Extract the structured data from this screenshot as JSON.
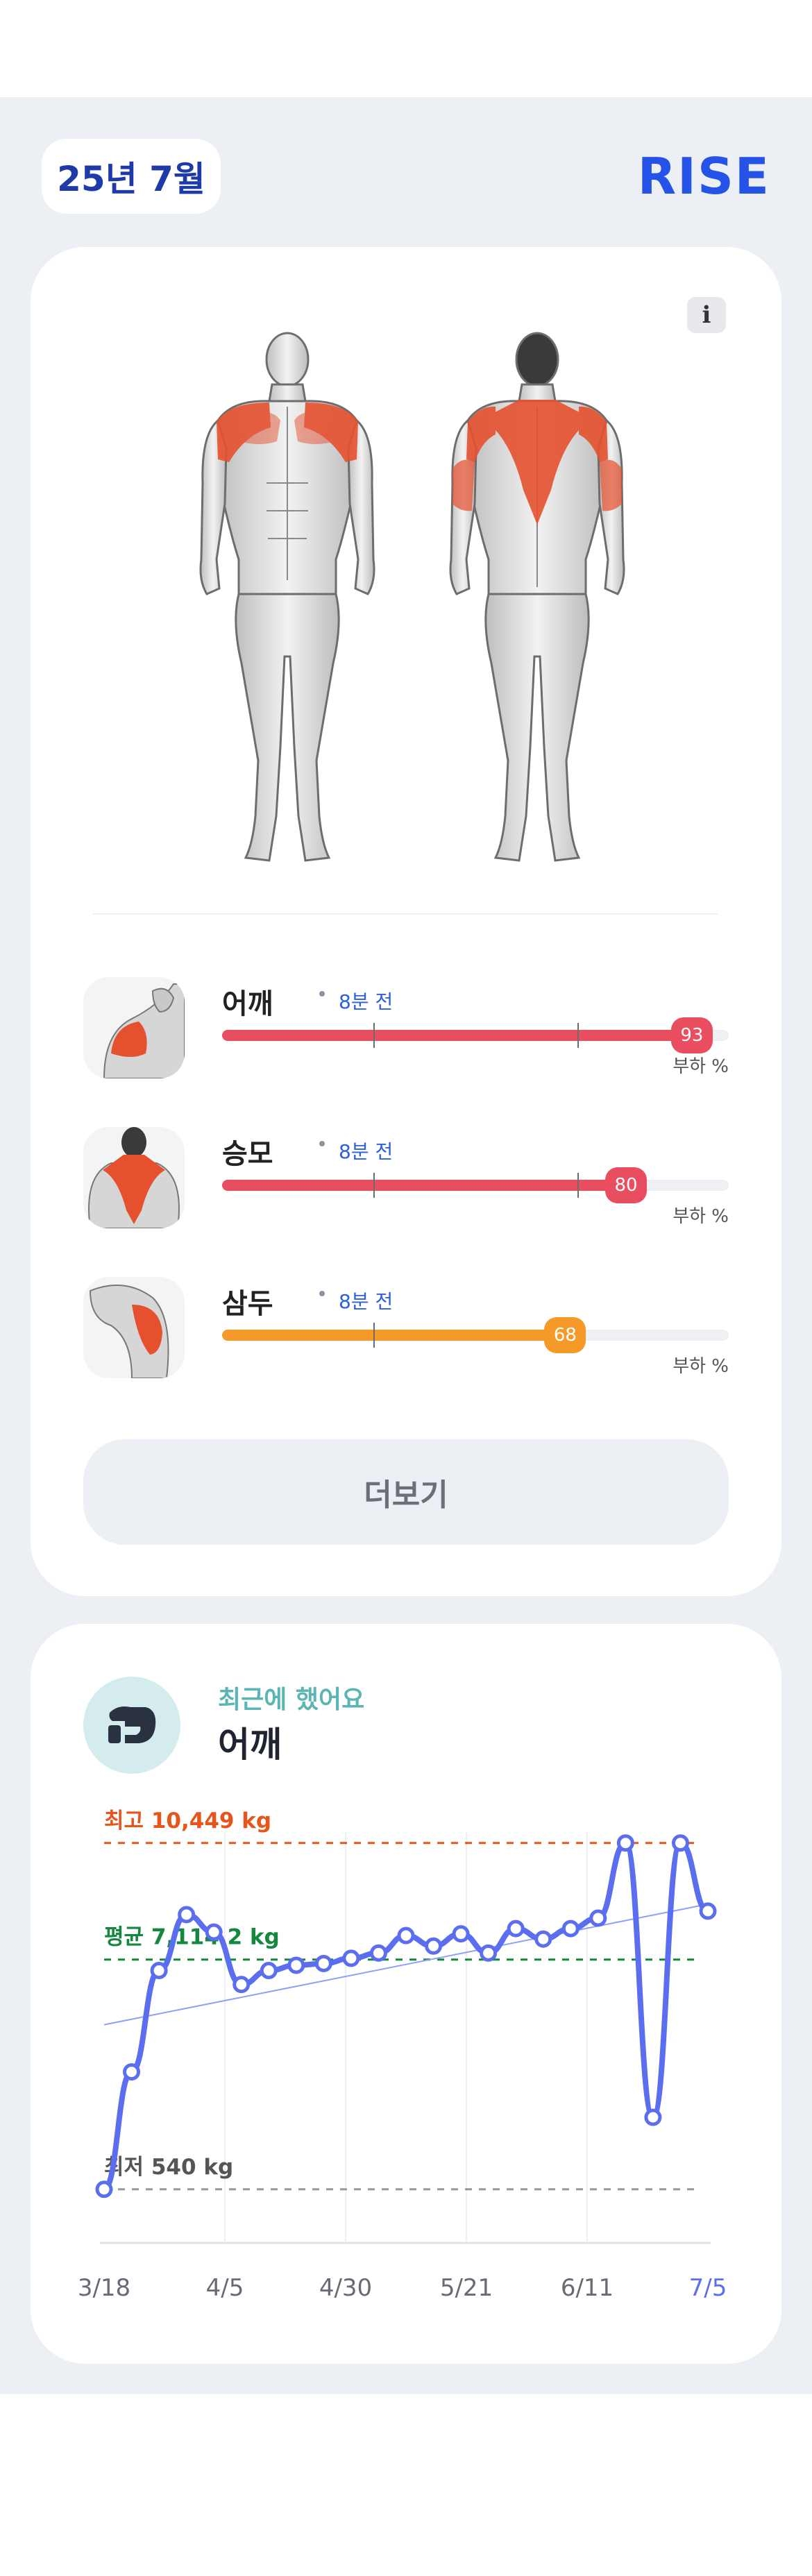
{
  "header": {
    "month": "25년 7월",
    "logo": "RISE"
  },
  "info_button": "i",
  "muscles": [
    {
      "name": "어깨",
      "time": "8분 전",
      "load": 93,
      "load_label": "부하 %",
      "color": "#e94e60"
    },
    {
      "name": "승모",
      "time": "8분 전",
      "load": 80,
      "load_label": "부하 %",
      "color": "#e94e60"
    },
    {
      "name": "삼두",
      "time": "8분 전",
      "load": 68,
      "load_label": "부하 %",
      "color": "#f59a28"
    }
  ],
  "more_button": "더보기",
  "progress": {
    "label": "최근에 했어요",
    "title": "어깨"
  },
  "chart_data": {
    "type": "line",
    "x_ticks": [
      "3/18",
      "4/5",
      "4/30",
      "5/21",
      "6/11",
      "7/5"
    ],
    "highlight_tick": "7/5",
    "reference_lines": [
      {
        "label": "최고 10,449 kg",
        "value": 10449,
        "color": "#e6561c"
      },
      {
        "label": "평균 7,114.2 kg",
        "value": 7114.2,
        "color": "#16873f"
      },
      {
        "label": "최저 540 kg",
        "value": 540,
        "color": "#999999"
      }
    ],
    "series": [
      {
        "values": [
          540,
          3900,
          6800,
          8400,
          7900,
          6400,
          6800,
          6950,
          7000,
          7150,
          7300,
          7800,
          7500,
          7850,
          7300,
          8000,
          7700,
          8000,
          8300,
          10449,
          2600,
          10449,
          8500
        ]
      }
    ],
    "trend_line": [
      5250,
      8700
    ],
    "ylim": [
      0,
      11000
    ],
    "line_color": "#5b6ef0"
  }
}
